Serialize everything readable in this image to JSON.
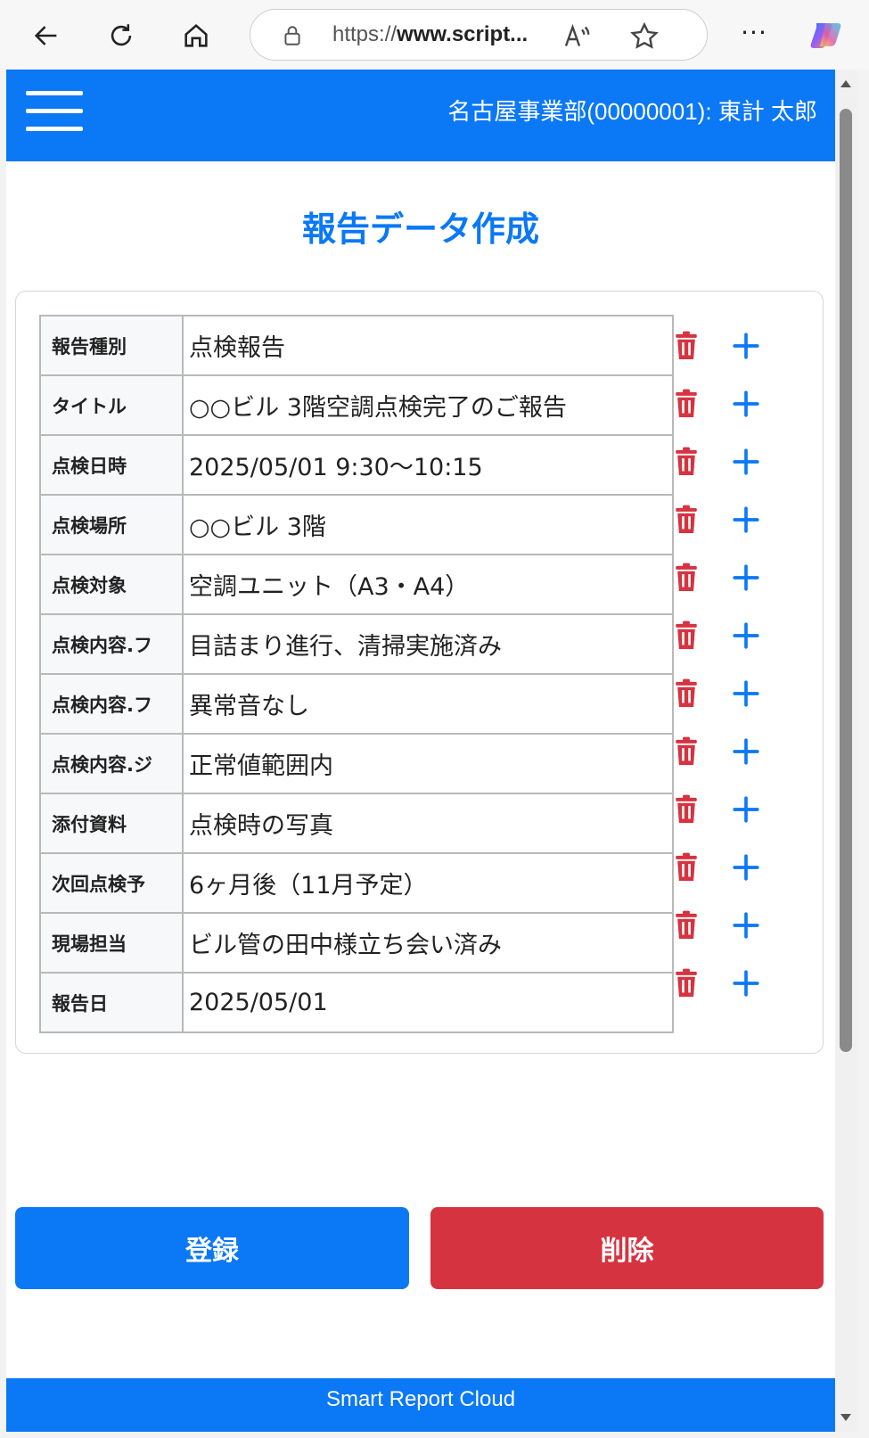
{
  "browser": {
    "url_prefix": "https://",
    "url_domain": "www.script...",
    "icons": [
      "back-arrow-icon",
      "refresh-icon",
      "home-icon",
      "lock-icon",
      "read-aloud-icon",
      "favorite-star-icon",
      "more-icon",
      "copilot-icon"
    ]
  },
  "header": {
    "user_info": "名古屋事業部(00000001): 東計 太郎",
    "color": "#0b78f6"
  },
  "page": {
    "title": "報告データ作成"
  },
  "fields": [
    {
      "label": "報告種別",
      "value": "点検報告"
    },
    {
      "label": "タイトル",
      "value": "○○ビル 3階空調点検完了のご報告"
    },
    {
      "label": "点検日時",
      "value": "2025/05/01 9:30～10:15"
    },
    {
      "label": "点検場所",
      "value": "○○ビル 3階"
    },
    {
      "label": "点検対象",
      "value": "空調ユニット（A3・A4）"
    },
    {
      "label": "点検内容.フ",
      "value": "目詰まり進行、清掃実施済み"
    },
    {
      "label": "点検内容.フ",
      "value": "異常音なし"
    },
    {
      "label": "点検内容.ジ",
      "value": "正常値範囲内"
    },
    {
      "label": "添付資料",
      "value": "点検時の写真"
    },
    {
      "label": "次回点検予",
      "value": "6ヶ月後（11月予定）"
    },
    {
      "label": "現場担当",
      "value": "ビル管の田中様立ち会い済み"
    },
    {
      "label": "報告日",
      "value": "2025/05/01"
    }
  ],
  "row_action_icons": [
    "trash-icon",
    "plus-icon"
  ],
  "actions": {
    "register_label": "登録",
    "delete_label": "削除",
    "register_color": "#0b78f6",
    "delete_color": "#d63341"
  },
  "footer": {
    "text": "Smart Report Cloud"
  }
}
